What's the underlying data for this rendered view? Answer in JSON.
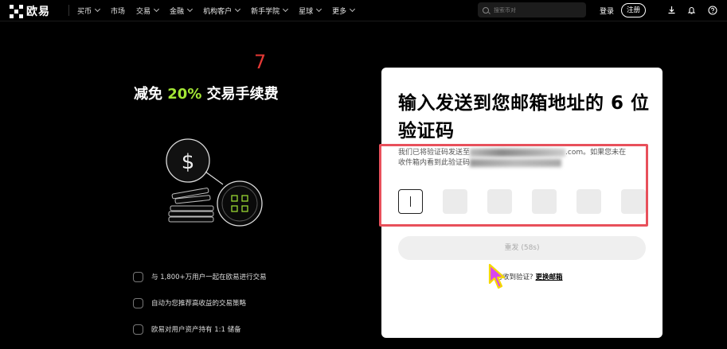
{
  "brand": {
    "name": "欧易"
  },
  "nav": {
    "items": [
      {
        "label": "买币",
        "has_dropdown": true
      },
      {
        "label": "市场",
        "has_dropdown": false
      },
      {
        "label": "交易",
        "has_dropdown": true
      },
      {
        "label": "金融",
        "has_dropdown": true
      },
      {
        "label": "机构客户",
        "has_dropdown": true
      },
      {
        "label": "新手学院",
        "has_dropdown": true
      },
      {
        "label": "星球",
        "has_dropdown": true
      },
      {
        "label": "更多",
        "has_dropdown": true
      }
    ],
    "search_placeholder": "搜索币对",
    "login_label": "登录",
    "signup_label": "注册",
    "icons": [
      "download-icon",
      "bell-icon",
      "help-icon"
    ]
  },
  "promo": {
    "title_prefix": "减免",
    "title_highlight": "20%",
    "title_suffix": "交易手续费",
    "highlight_color": "#a3e635",
    "features": [
      "与 1,800+万用户一起在欧易进行交易",
      "自动为您推荐高收益的交易策略",
      "欧易对用户资产持有 1:1 储备"
    ]
  },
  "verify": {
    "title": "输入发送到您邮箱地址的 6 位验证码",
    "step_number": "7",
    "desc_part1": "我们已将验证码发送至",
    "desc_part2": ".com。如果您未在",
    "desc_part3": "收件箱内看到此验证码",
    "code_length": 6,
    "resend_label": "重发 (58s)",
    "alt_question": "没有收到验证?",
    "alt_link": "更换邮箱"
  },
  "colors": {
    "highlight_border": "#e8505b",
    "step_number": "#e53935"
  }
}
